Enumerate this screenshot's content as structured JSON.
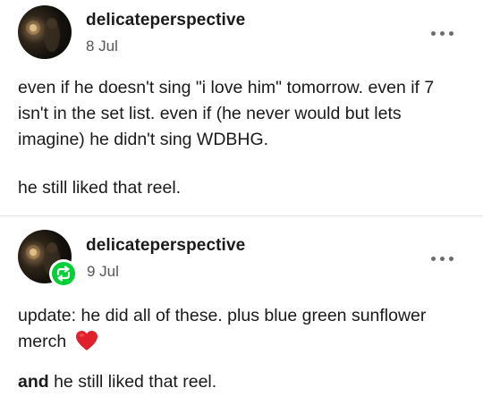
{
  "posts": [
    {
      "username": "delicateperspective",
      "date": "8 Jul",
      "paragraphs": [
        "even if he doesn't sing \"i love him\" tomorrow. even if 7 isn't in the set list. even if (he never would but lets imagine) he didn't sing WDBHG.",
        "he still liked that reel."
      ]
    },
    {
      "username": "delicateperspective",
      "date": "9 Jul",
      "reblog_badge_icon": "reblog-icon",
      "paragraph_1": "update: he did all of these. plus blue green sunflower merch",
      "paragraph_1_emoji": "heart-emoji",
      "paragraph_2_bold": "and",
      "paragraph_2_rest": " he still liked that reel."
    }
  ],
  "more_icon": "more-options-icon",
  "colors": {
    "reblog_green": "#00cf35",
    "heart_red": "#e0202a",
    "text": "#1a1a1a",
    "muted": "#555555"
  }
}
